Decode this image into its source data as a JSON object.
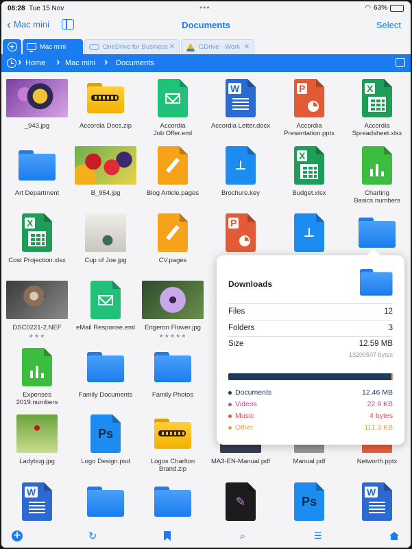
{
  "status": {
    "time": "08:28",
    "date": "Tue 15 Nov",
    "battery": "63%",
    "battery_level": 0.63
  },
  "nav": {
    "back_label": "Mac mini",
    "title": "Documents",
    "select_label": "Select"
  },
  "tabs": [
    {
      "label": "Mac mini",
      "active": true
    },
    {
      "label": "OneDrive for Business",
      "active": false
    },
    {
      "label": "GDrive - Work",
      "active": false
    }
  ],
  "breadcrumb": [
    "Home",
    "Mac mini",
    "Documents"
  ],
  "files": [
    {
      "name": "_943.jpg",
      "kind": "photo",
      "style": "ph-wasp"
    },
    {
      "name": "Accordia Docs.zip",
      "kind": "zipfolder"
    },
    {
      "name": "Accordia\nJob Offer.eml",
      "kind": "mail"
    },
    {
      "name": "Accordia Letter.docx",
      "kind": "word"
    },
    {
      "name": "Accordia\nPresentation.pptx",
      "kind": "ppt"
    },
    {
      "name": "Accordia\nSpreadsheet.xlsx",
      "kind": "xls"
    },
    {
      "name": "Art Department",
      "kind": "folder"
    },
    {
      "name": "B_954.jpg",
      "kind": "photo",
      "style": "ph-fruit"
    },
    {
      "name": "Blog Article.pages",
      "kind": "pages"
    },
    {
      "name": "Brochure.key",
      "kind": "key"
    },
    {
      "name": "Budget.xlsx",
      "kind": "xls"
    },
    {
      "name": "Charting\nBasics.numbers",
      "kind": "numbers"
    },
    {
      "name": "Cost Projection.xlsx",
      "kind": "xls"
    },
    {
      "name": "Cup of Joe.jpg",
      "kind": "photo",
      "style": "ph-cup"
    },
    {
      "name": "CV.pages",
      "kind": "pages"
    },
    {
      "name": "",
      "kind": "ppt"
    },
    {
      "name": "",
      "kind": "key"
    },
    {
      "name": "",
      "kind": "folder"
    },
    {
      "name": "DSC0221-2.NEF",
      "kind": "photo",
      "style": "ph-owl",
      "stars": "★★★"
    },
    {
      "name": "eMail Response.eml",
      "kind": "mail"
    },
    {
      "name": "Erigeron Flower.jpg",
      "kind": "photo",
      "style": "ph-flower",
      "stars": "★★★★★"
    },
    {
      "name": "",
      "kind": "none"
    },
    {
      "name": "",
      "kind": "none"
    },
    {
      "name": "",
      "kind": "none"
    },
    {
      "name": "Expenses\n2019.numbers",
      "kind": "numbers"
    },
    {
      "name": "Family Documents",
      "kind": "folder"
    },
    {
      "name": "Family Photos",
      "kind": "folder"
    },
    {
      "name": "",
      "kind": "none"
    },
    {
      "name": "",
      "kind": "none"
    },
    {
      "name": "",
      "kind": "none"
    },
    {
      "name": "Ladybug.jpg",
      "kind": "photo",
      "style": "ph-lady"
    },
    {
      "name": "Logo Design.psd",
      "kind": "psd"
    },
    {
      "name": "Logos Charlton\nBrand.zip",
      "kind": "zipfolder"
    },
    {
      "name": "MA3-EN-Manual.pdf",
      "kind": "photo",
      "style": "ph-dark"
    },
    {
      "name": "Manual.pdf",
      "kind": "photo",
      "style": "ph-grey"
    },
    {
      "name": "Networth.pptx",
      "kind": "photo",
      "style": "ph-red"
    },
    {
      "name": "",
      "kind": "word"
    },
    {
      "name": "",
      "kind": "folder"
    },
    {
      "name": "",
      "kind": "folder"
    },
    {
      "name": "",
      "kind": "procreate"
    },
    {
      "name": "",
      "kind": "psd"
    },
    {
      "name": "",
      "kind": "word"
    }
  ],
  "popover": {
    "title": "Downloads",
    "files_label": "Files",
    "files_value": "12",
    "folders_label": "Folders",
    "folders_value": "3",
    "size_label": "Size",
    "size_value": "12.59 MB",
    "size_bytes": "13200507 bytes",
    "usage": [
      {
        "name": "Documents",
        "value": "12.46 MB",
        "color": "#1e3a5a",
        "fraction": 0.9899
      },
      {
        "name": "Videos",
        "value": "22.9 KB",
        "color": "#c44a9a",
        "fraction": 0.0018
      },
      {
        "name": "Music",
        "value": "4 bytes",
        "color": "#e0505a",
        "fraction": 0.0003
      },
      {
        "name": "Other",
        "value": "111.3 KB",
        "color": "#f0a030",
        "fraction": 0.0088
      }
    ]
  },
  "toolbar": {
    "items": [
      "add-icon",
      "refresh-icon",
      "bookmark-icon",
      "search-icon",
      "sort-icon",
      "home-icon"
    ]
  }
}
